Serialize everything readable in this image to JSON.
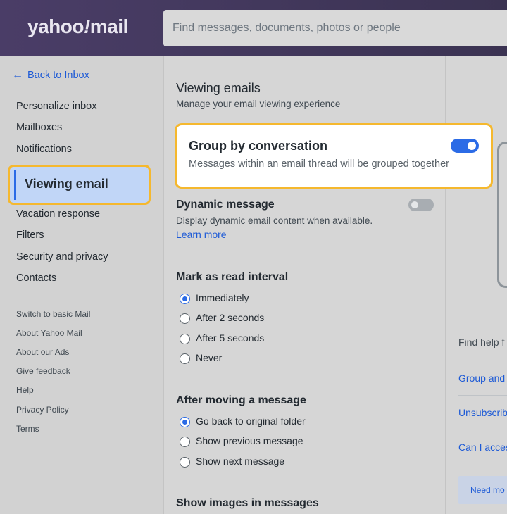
{
  "header": {
    "logo_text_a": "yahoo",
    "logo_text_slash": "!",
    "logo_text_b": "mail",
    "search_placeholder": "Find messages, documents, photos or people"
  },
  "sidebar": {
    "back_label": "Back to Inbox",
    "items": [
      {
        "label": "Personalize inbox"
      },
      {
        "label": "Mailboxes"
      },
      {
        "label": "Notifications"
      },
      {
        "label": "Viewing email",
        "active": true
      },
      {
        "label": "Vacation response"
      },
      {
        "label": "Filters"
      },
      {
        "label": "Security and privacy"
      },
      {
        "label": "Contacts"
      }
    ],
    "links": [
      {
        "label": "Switch to basic Mail"
      },
      {
        "label": "About Yahoo Mail"
      },
      {
        "label": "About our Ads"
      },
      {
        "label": "Give feedback"
      },
      {
        "label": "Help"
      },
      {
        "label": "Privacy Policy"
      },
      {
        "label": "Terms"
      }
    ]
  },
  "main": {
    "title": "Viewing emails",
    "subtitle": "Manage your email viewing experience",
    "group_by": {
      "title": "Group by conversation",
      "description": "Messages within an email thread will be grouped together",
      "enabled": true
    },
    "dynamic": {
      "title": "Dynamic message",
      "description": "Display dynamic email content when available.",
      "learn_more": "Learn more",
      "enabled": false
    },
    "mark_read": {
      "title": "Mark as read interval",
      "options": [
        {
          "label": "Immediately",
          "checked": true
        },
        {
          "label": "After 2 seconds",
          "checked": false
        },
        {
          "label": "After 5 seconds",
          "checked": false
        },
        {
          "label": "Never",
          "checked": false
        }
      ]
    },
    "after_move": {
      "title": "After moving a message",
      "options": [
        {
          "label": "Go back to original folder",
          "checked": true
        },
        {
          "label": "Show previous message",
          "checked": false
        },
        {
          "label": "Show next message",
          "checked": false
        }
      ]
    },
    "show_images": {
      "title": "Show images in messages"
    }
  },
  "right": {
    "help_title": "Find help f",
    "links": [
      {
        "label": "Group and"
      },
      {
        "label": "Unsubscrib"
      },
      {
        "label": "Can I acces"
      }
    ],
    "need_more": "Need mo"
  },
  "colors": {
    "accent": "#2b6be6",
    "highlight": "#f5b82e",
    "header": "#4a3d67"
  }
}
